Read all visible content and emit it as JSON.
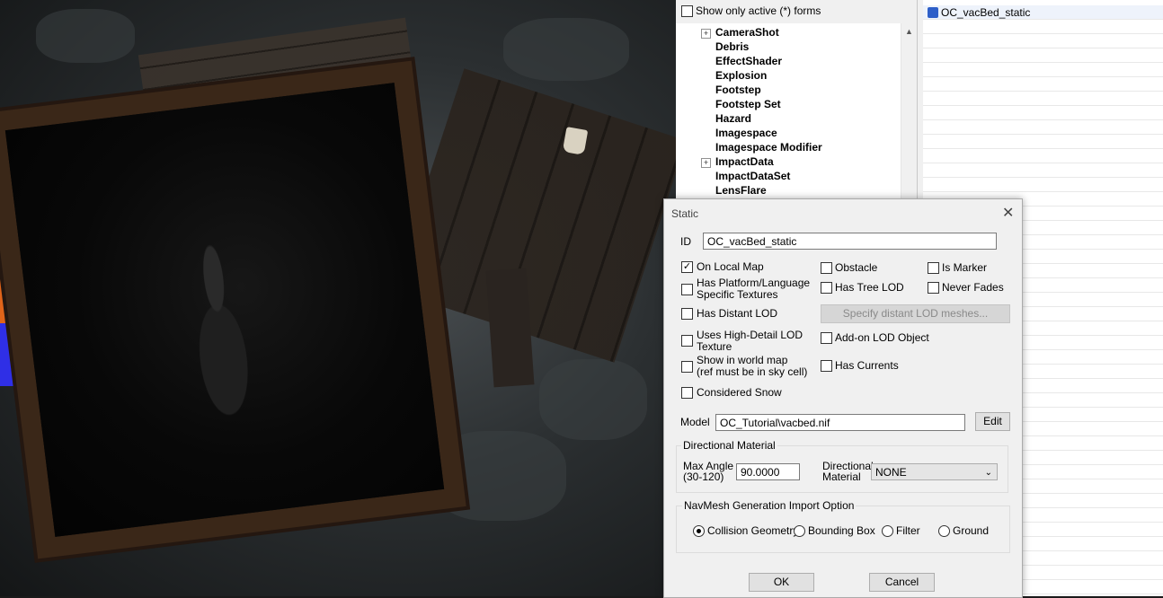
{
  "object_window": {
    "filter_label": "Show only active (*) forms",
    "tree_items": [
      {
        "label": "CameraShot",
        "expandable": true
      },
      {
        "label": "Debris",
        "expandable": false
      },
      {
        "label": "EffectShader",
        "expandable": false
      },
      {
        "label": "Explosion",
        "expandable": false
      },
      {
        "label": "Footstep",
        "expandable": false
      },
      {
        "label": "Footstep Set",
        "expandable": false
      },
      {
        "label": "Hazard",
        "expandable": false
      },
      {
        "label": "Imagespace",
        "expandable": false
      },
      {
        "label": "Imagespace Modifier",
        "expandable": false
      },
      {
        "label": "ImpactData",
        "expandable": true
      },
      {
        "label": "ImpactDataSet",
        "expandable": false
      },
      {
        "label": "LensFlare",
        "expandable": false
      }
    ],
    "list_items": [
      "OC_vacBed_static"
    ]
  },
  "dialog": {
    "title": "Static",
    "close_glyph": "✕",
    "id_label": "ID",
    "id_value": "OC_vacBed_static",
    "checkboxes": {
      "on_local_map": {
        "label": "On Local Map",
        "checked": true
      },
      "obstacle": {
        "label": "Obstacle",
        "checked": false
      },
      "is_marker": {
        "label": "Is Marker",
        "checked": false
      },
      "has_platform_line1": "Has Platform/Language",
      "has_platform_line2": "Specific Textures",
      "has_tree_lod": {
        "label": "Has Tree LOD",
        "checked": false
      },
      "never_fades": {
        "label": "Never Fades",
        "checked": false
      },
      "has_distant_lod": {
        "label": "Has Distant LOD",
        "checked": false
      },
      "uses_high_detail_line1": "Uses High-Detail LOD",
      "uses_high_detail_line2": "Texture",
      "addon_lod": {
        "label": "Add-on LOD Object",
        "checked": false
      },
      "show_world_map_line1": "Show in world map",
      "show_world_map_line2": "(ref must be in sky cell)",
      "has_currents": {
        "label": "Has Currents",
        "checked": false
      },
      "considered_snow": {
        "label": "Considered Snow",
        "checked": false
      }
    },
    "specify_lod_button": "Specify distant LOD meshes...",
    "model_label": "Model",
    "model_value": "OC_Tutorial\\vacbed.nif",
    "edit_button": "Edit",
    "directional_material": {
      "group_title": "Directional Material",
      "max_angle_line1": "Max Angle",
      "max_angle_line2": "(30-120)",
      "max_angle_value": "90.0000",
      "material_line1": "Directional",
      "material_line2": "Material",
      "material_value": "NONE"
    },
    "navmesh": {
      "group_title": "NavMesh Generation Import Option",
      "options": [
        {
          "label": "Collision Geometry",
          "selected": true
        },
        {
          "label": "Bounding Box",
          "selected": false
        },
        {
          "label": "Filter",
          "selected": false
        },
        {
          "label": "Ground",
          "selected": false
        }
      ]
    },
    "ok_button": "OK",
    "cancel_button": "Cancel"
  }
}
